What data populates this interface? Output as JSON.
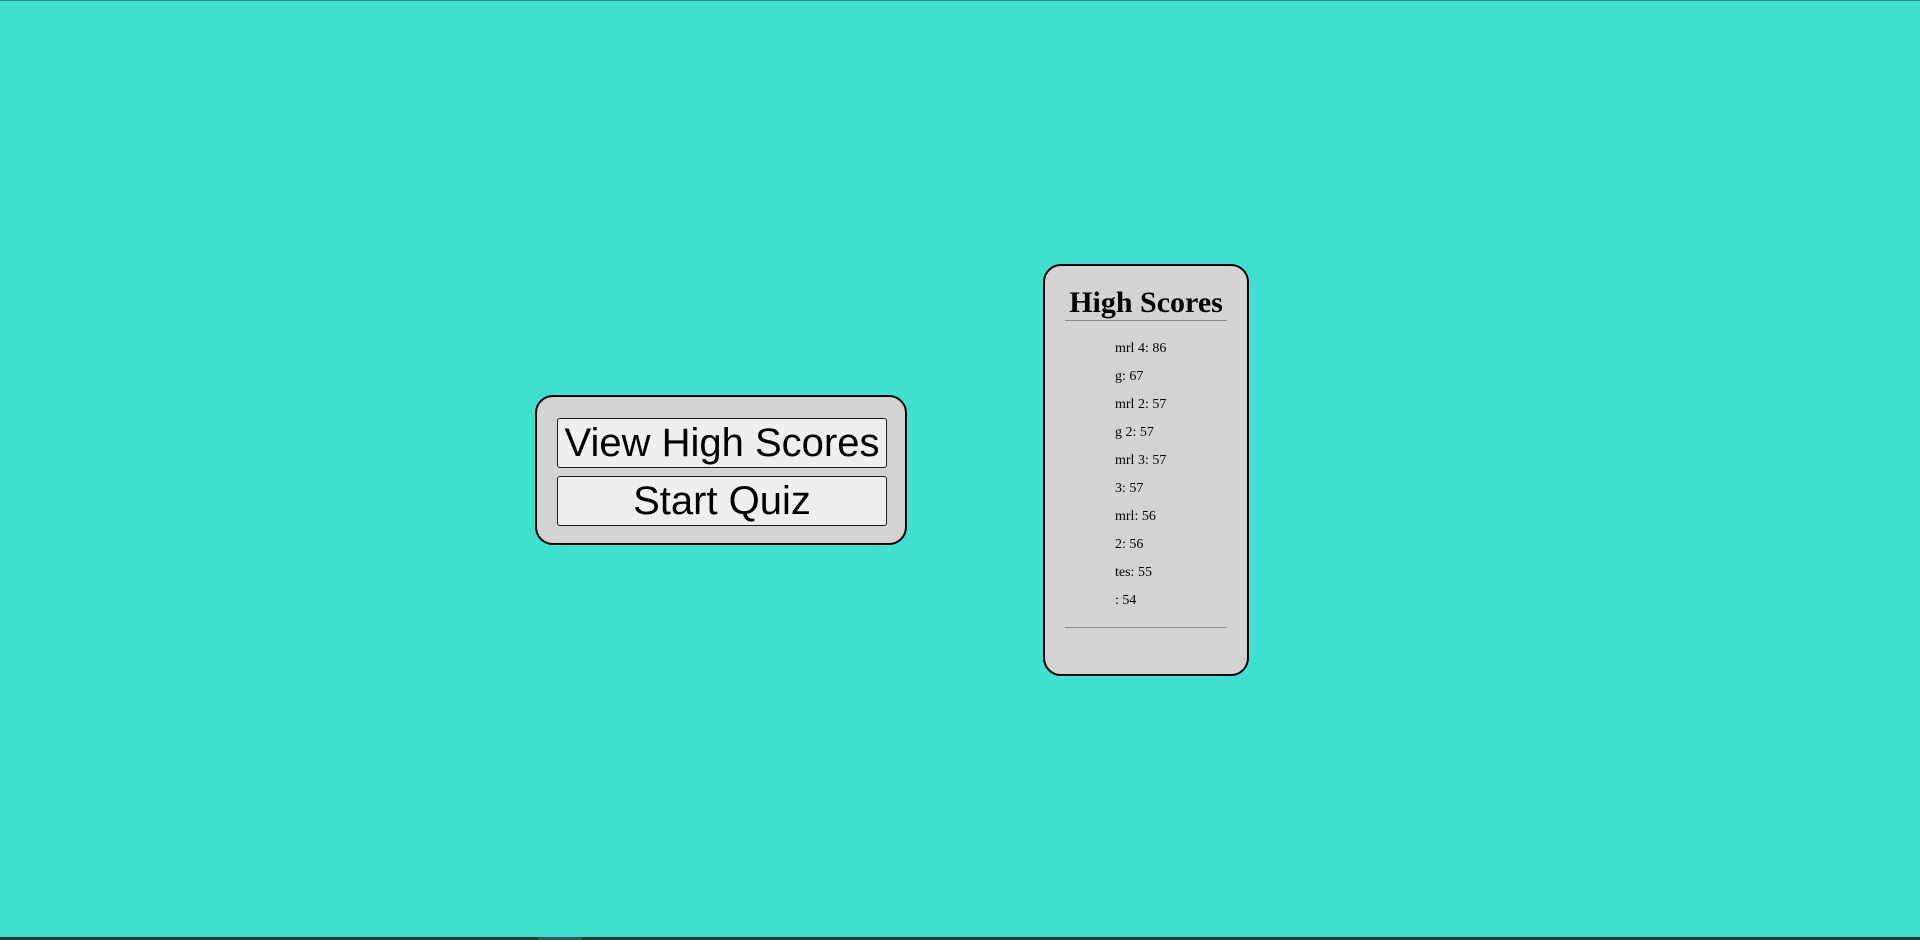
{
  "page": {
    "background_color": "#40E0D0",
    "panel_color": "#D3D3D3"
  },
  "menu": {
    "view_high_scores_label": "View High Scores",
    "start_quiz_label": "Start Quiz"
  },
  "high_scores": {
    "title": "High Scores",
    "entries": [
      "mrl 4: 86",
      "g: 67",
      "mrl 2: 57",
      "g 2: 57",
      "mrl 3: 57",
      "3: 57",
      "mrl: 56",
      "2: 56",
      "tes: 55",
      ": 54"
    ]
  }
}
